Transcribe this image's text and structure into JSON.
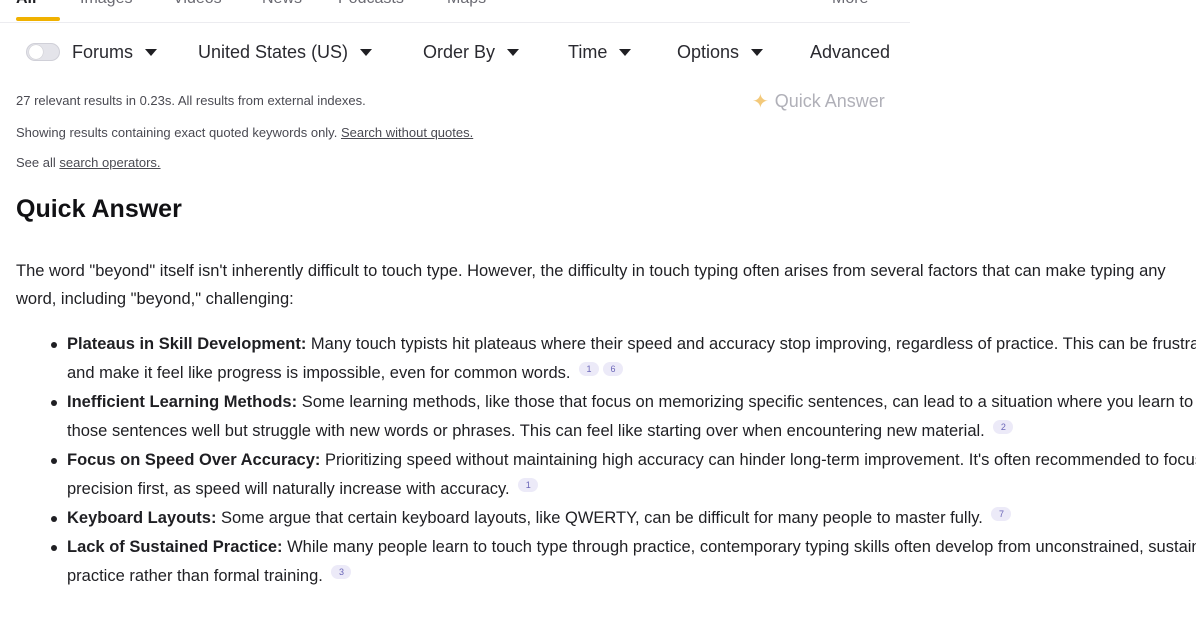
{
  "tabs": [
    {
      "label": "All",
      "active": true
    },
    {
      "label": "Images"
    },
    {
      "label": "Videos"
    },
    {
      "label": "News"
    },
    {
      "label": "Podcasts"
    },
    {
      "label": "Maps"
    },
    {
      "label": "More"
    }
  ],
  "filters": {
    "forums": "Forums",
    "region": "United States (US)",
    "order_by": "Order By",
    "time": "Time",
    "options": "Options",
    "advanced": "Advanced"
  },
  "meta": {
    "results_summary": "27 relevant results in 0.23s. All results from external indexes.",
    "quoted_notice": "Showing results containing exact quoted keywords only.",
    "search_without_quotes": "Search without quotes.",
    "see_all_prefix": "See all",
    "search_operators": "search operators."
  },
  "quick_answer_button": "Quick Answer",
  "quick_answer": {
    "title": "Quick Answer",
    "intro": "The word \"beyond\" itself isn't inherently difficult to touch type. However, the difficulty in touch typing often arises from several factors that can make typing any word, including \"beyond,\" challenging:",
    "points": [
      {
        "term": "Plateaus in Skill Development:",
        "text": "Many touch typists hit plateaus where their speed and accuracy stop improving, regardless of practice. This can be frustrating and make it feel like progress is impossible, even for common words.",
        "citations": [
          "1",
          "6"
        ]
      },
      {
        "term": "Inefficient Learning Methods:",
        "text": "Some learning methods, like those that focus on memorizing specific sentences, can lead to a situation where you learn to type those sentences well but struggle with new words or phrases. This can feel like starting over when encountering new material.",
        "citations": [
          "2"
        ]
      },
      {
        "term": "Focus on Speed Over Accuracy:",
        "text": "Prioritizing speed without maintaining high accuracy can hinder long-term improvement. It's often recommended to focus on precision first, as speed will naturally increase with accuracy.",
        "citations": [
          "1"
        ]
      },
      {
        "term": "Keyboard Layouts:",
        "text": "Some argue that certain keyboard layouts, like QWERTY, can be difficult for many people to master fully.",
        "citations": [
          "7"
        ]
      },
      {
        "term": "Lack of Sustained Practice:",
        "text": "While many people learn to touch type through practice, contemporary typing skills often develop from unconstrained, sustained practice rather than formal training.",
        "citations": [
          "3"
        ]
      }
    ]
  },
  "colors": {
    "accent": "#f0b100",
    "citation_bg": "#eceaf8",
    "citation_text": "#6b66b8"
  }
}
